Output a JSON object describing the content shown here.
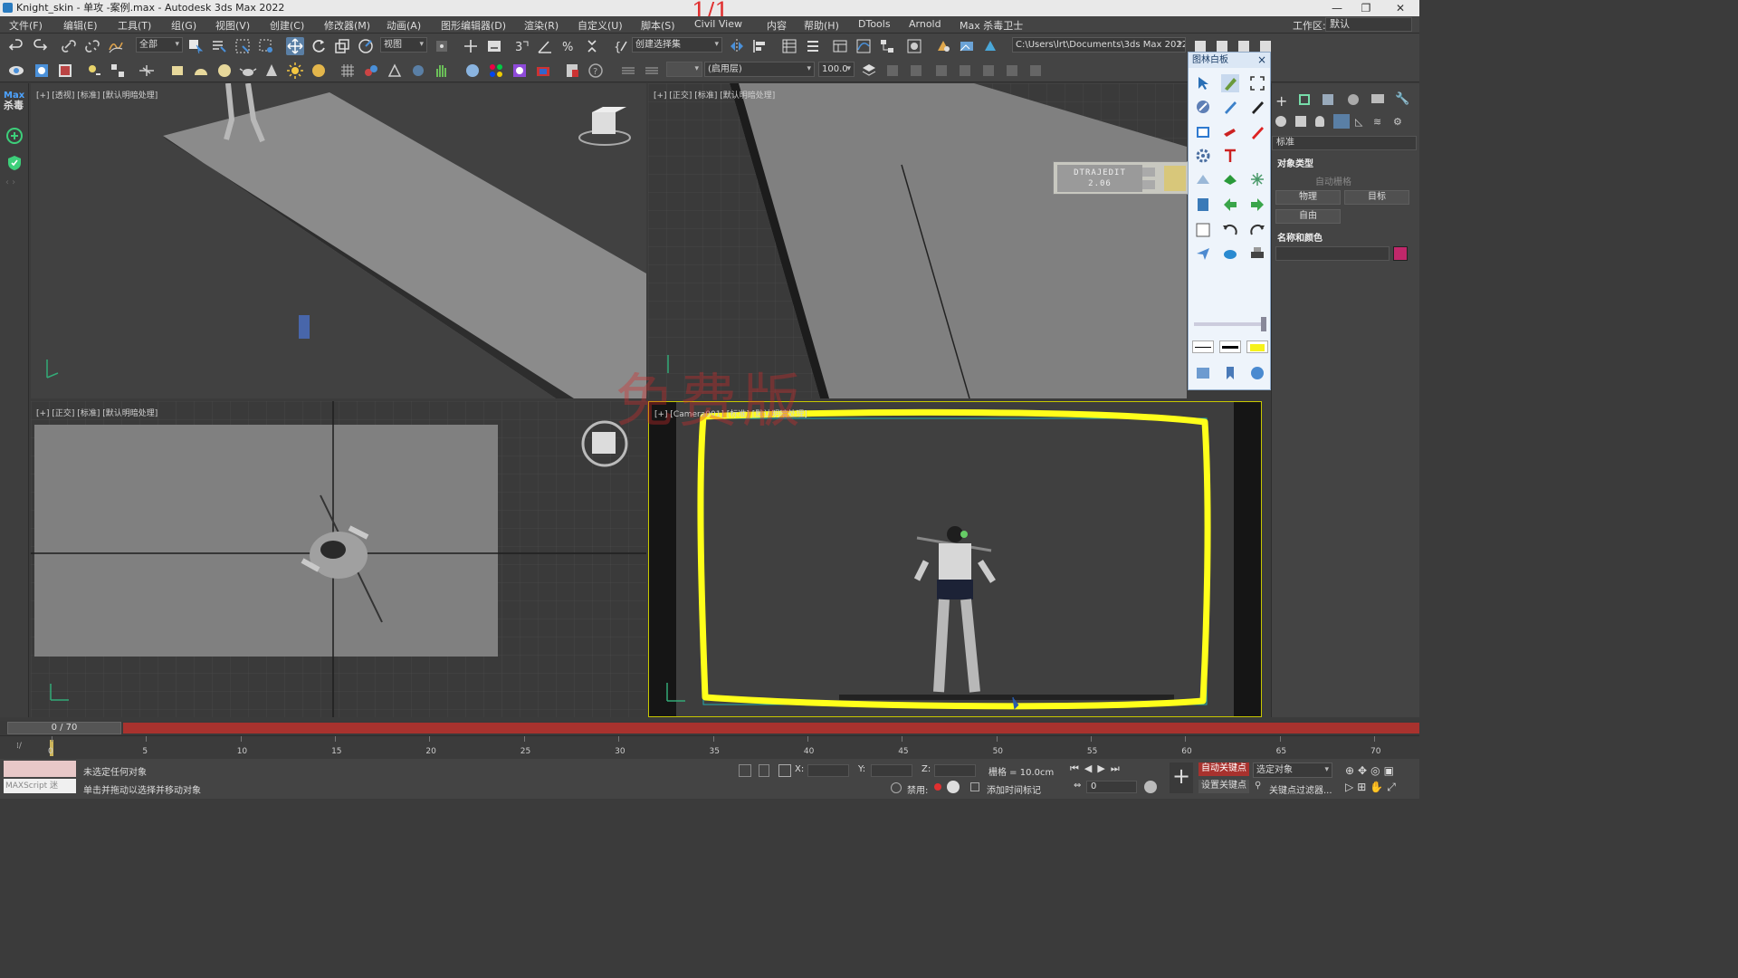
{
  "window": {
    "title": "Knight_skin - 单攻 -案例.max - Autodesk 3ds Max 2022",
    "overlay_page": "1/1"
  },
  "menubar": {
    "items": [
      "文件(F)",
      "编辑(E)",
      "工具(T)",
      "组(G)",
      "视图(V)",
      "创建(C)",
      "修改器(M)",
      "动画(A)",
      "图形编辑器(D)",
      "渲染(R)",
      "自定义(U)",
      "脚本(S)",
      "Civil View",
      "内容",
      "帮助(H)",
      "DTools",
      "Arnold",
      "Max 杀毒卫士"
    ],
    "workspace_label": "工作区:",
    "workspace_value": "默认"
  },
  "toolbar": {
    "selection_filter": "全部",
    "reference_coord": "视图",
    "named_selection": "创建选择集",
    "project_path": "C:\\Users\\lrt\\Documents\\3ds Max 2022",
    "layer_field": "(启用层)",
    "percent": "100.0"
  },
  "leftstrip": {
    "logo_top": "Max",
    "logo_bottom": "杀毒"
  },
  "viewports": {
    "perspective": "[+] [透视] [标准] [默认明暗处理]",
    "front": "[+] [正交] [标准] [默认明暗处理]",
    "top": "[+] [正交] [标准] [默认明暗处理]",
    "camera": "[+] [Camera001] [标准] [默认明暗处理]"
  },
  "watermark": "免费版",
  "dtraj": {
    "name": "DTRAJEDIT",
    "version": "2.06"
  },
  "palette": {
    "title": "图林白板",
    "close": "×"
  },
  "command_panel": {
    "dropdown": "标准",
    "object_type_heading": "对象类型",
    "autogrid": "自动栅格",
    "btn_physical": "物理",
    "btn_target": "目标",
    "btn_free": "自由",
    "name_color_heading": "名称和颜色",
    "object_color": "#c0286a"
  },
  "timeline": {
    "frame_display": "0 / 70",
    "ticks": [
      "0",
      "5",
      "10",
      "15",
      "20",
      "25",
      "30",
      "35",
      "40",
      "45",
      "50",
      "55",
      "60",
      "65",
      "70"
    ]
  },
  "statusbar": {
    "maxscript": "MAXScript 迷",
    "status1": "未选定任何对象",
    "status2": "单击并拖动以选择并移动对象",
    "x_label": "X:",
    "y_label": "Y:",
    "z_label": "Z:",
    "grid": "栅格 = 10.0cm",
    "disabled": "禁用:",
    "add_time_tag": "添加时间标记",
    "auto_key": "自动关键点",
    "selected_object": "选定对象",
    "set_key": "设置关键点",
    "key_filter": "关键点过滤器...",
    "frame_input": "0"
  }
}
